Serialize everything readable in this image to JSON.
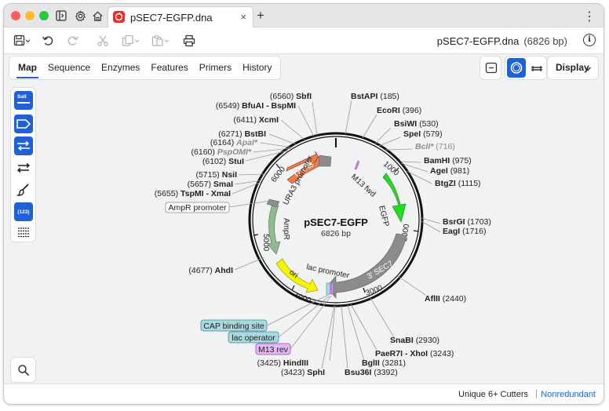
{
  "window": {
    "tab_title": "pSEC7-EGFP.dna",
    "close_glyph": "×",
    "new_tab_glyph": "+",
    "menu_glyph": "⋮"
  },
  "toolbar": {
    "filename": "pSEC7-EGFP.dna",
    "bp_label": "(6826 bp)",
    "info_glyph": "i"
  },
  "view_tabs": [
    {
      "label": "Map",
      "active": true
    },
    {
      "label": "Sequence",
      "active": false
    },
    {
      "label": "Enzymes",
      "active": false
    },
    {
      "label": "Features",
      "active": false
    },
    {
      "label": "Primers",
      "active": false
    },
    {
      "label": "History",
      "active": false
    }
  ],
  "display_button": {
    "label": "Display"
  },
  "side_tools": {
    "sali_label": "SalI",
    "orf_label": "(123)"
  },
  "map": {
    "name": "pSEC7-EGFP",
    "length_label": "6826 bp",
    "ticks": [
      "1000",
      "2000",
      "3000",
      "4000",
      "5000",
      "6000"
    ],
    "enzymes_right": [
      {
        "name": "BstAPI",
        "pos": "(185)"
      },
      {
        "name": "EcoRI",
        "pos": "(396)"
      },
      {
        "name": "BsiWI",
        "pos": "(530)"
      },
      {
        "name": "SpeI",
        "pos": "(579)"
      },
      {
        "name": "BclI*",
        "pos": "(716)",
        "dim": true
      },
      {
        "name": "BamHI",
        "pos": "(975)"
      },
      {
        "name": "AgeI",
        "pos": "(981)"
      },
      {
        "name": "BtgZI",
        "pos": "(1115)"
      },
      {
        "name": "BsrGI",
        "pos": "(1703)"
      },
      {
        "name": "EagI",
        "pos": "(1716)"
      },
      {
        "name": "AflII",
        "pos": "(2440)"
      },
      {
        "name": "SnaBI",
        "pos": "(2930)"
      },
      {
        "name": "PaeR7I - XhoI",
        "pos": "(3243)"
      },
      {
        "name": "BglII",
        "pos": "(3281)"
      },
      {
        "name": "Bsu36I",
        "pos": "(3392)"
      }
    ],
    "enzymes_left": [
      {
        "name": "SbfI",
        "pos": "(6560)"
      },
      {
        "name": "BfuAI - BspMI",
        "pos": "(6549)"
      },
      {
        "name": "XcmI",
        "pos": "(6411)"
      },
      {
        "name": "BstBI",
        "pos": "(6271)"
      },
      {
        "name": "ApaI*",
        "pos": "(6164)",
        "dim": true
      },
      {
        "name": "PspOMI*",
        "pos": "(6160)",
        "dim": true
      },
      {
        "name": "StuI",
        "pos": "(6102)"
      },
      {
        "name": "NsiI",
        "pos": "(5715)"
      },
      {
        "name": "SmaI",
        "pos": "(5657)"
      },
      {
        "name": "TspMI - XmaI",
        "pos": "(5655)"
      },
      {
        "name": "AhdI",
        "pos": "(4677)"
      },
      {
        "name": "HindIII",
        "pos": "(3425)"
      },
      {
        "name": "SphI",
        "pos": "(3423)"
      }
    ],
    "features": {
      "ura3": "URA3",
      "ura3_promoter": "URA3 promoter",
      "m13_fwd": "M13 fwd",
      "egfp": "EGFP",
      "sec7": "3' SEC7",
      "lac_promoter": "lac promoter",
      "ori": "ori",
      "ampr": "AmpR",
      "ampr_promoter": "AmpR promoter",
      "cap_site": "CAP binding site",
      "lac_operator": "lac operator",
      "m13_rev": "M13 rev"
    },
    "colors": {
      "ura3": "#f47a4a",
      "egfp": "#1ee01e",
      "sec7": "#8c8c8c",
      "ori": "#f5f500",
      "ampr": "#8fbc8f",
      "m13": "#c07ad8",
      "cap": "#a8d8e0",
      "accent": "#1f62d6"
    }
  },
  "status": {
    "cutters": "Unique 6+ Cutters",
    "separator": "|",
    "mode": "Nonredundant"
  }
}
